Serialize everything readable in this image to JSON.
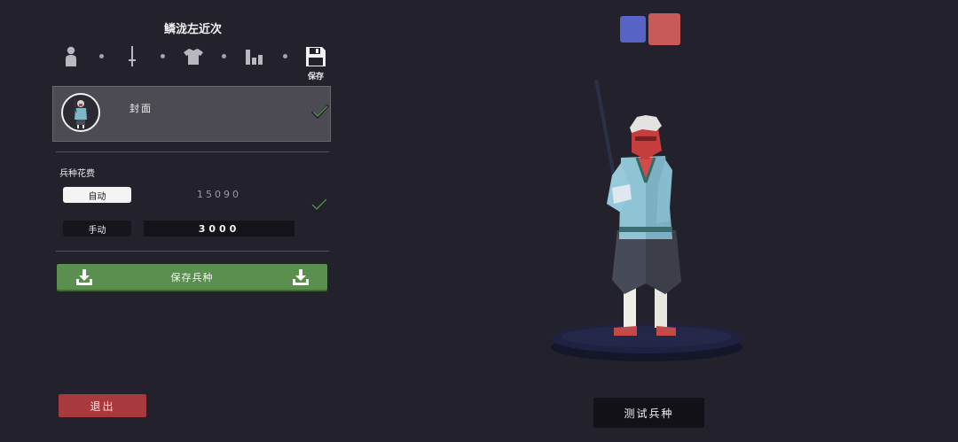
{
  "unit_name": "鳞泷左近次",
  "steps": {
    "icons": [
      "person-icon",
      "sword-icon",
      "shirt-icon",
      "stats-icon",
      "floppy-disk-icon"
    ],
    "save_label": "保存"
  },
  "cover": {
    "label": "封面",
    "checked": true
  },
  "cost": {
    "heading": "兵种花费",
    "auto_label": "自动",
    "auto_value": "15090",
    "manual_label": "手动",
    "manual_value": "3000",
    "checked": true
  },
  "save_unit_label": "保存兵种",
  "exit_label": "退出",
  "test_label": "测试兵种",
  "colors": {
    "team_blue": "#5764c6",
    "team_red": "#c85a5a",
    "save_green": "#5b8f4f",
    "exit_red": "#a8393d",
    "background": "#23222c"
  }
}
